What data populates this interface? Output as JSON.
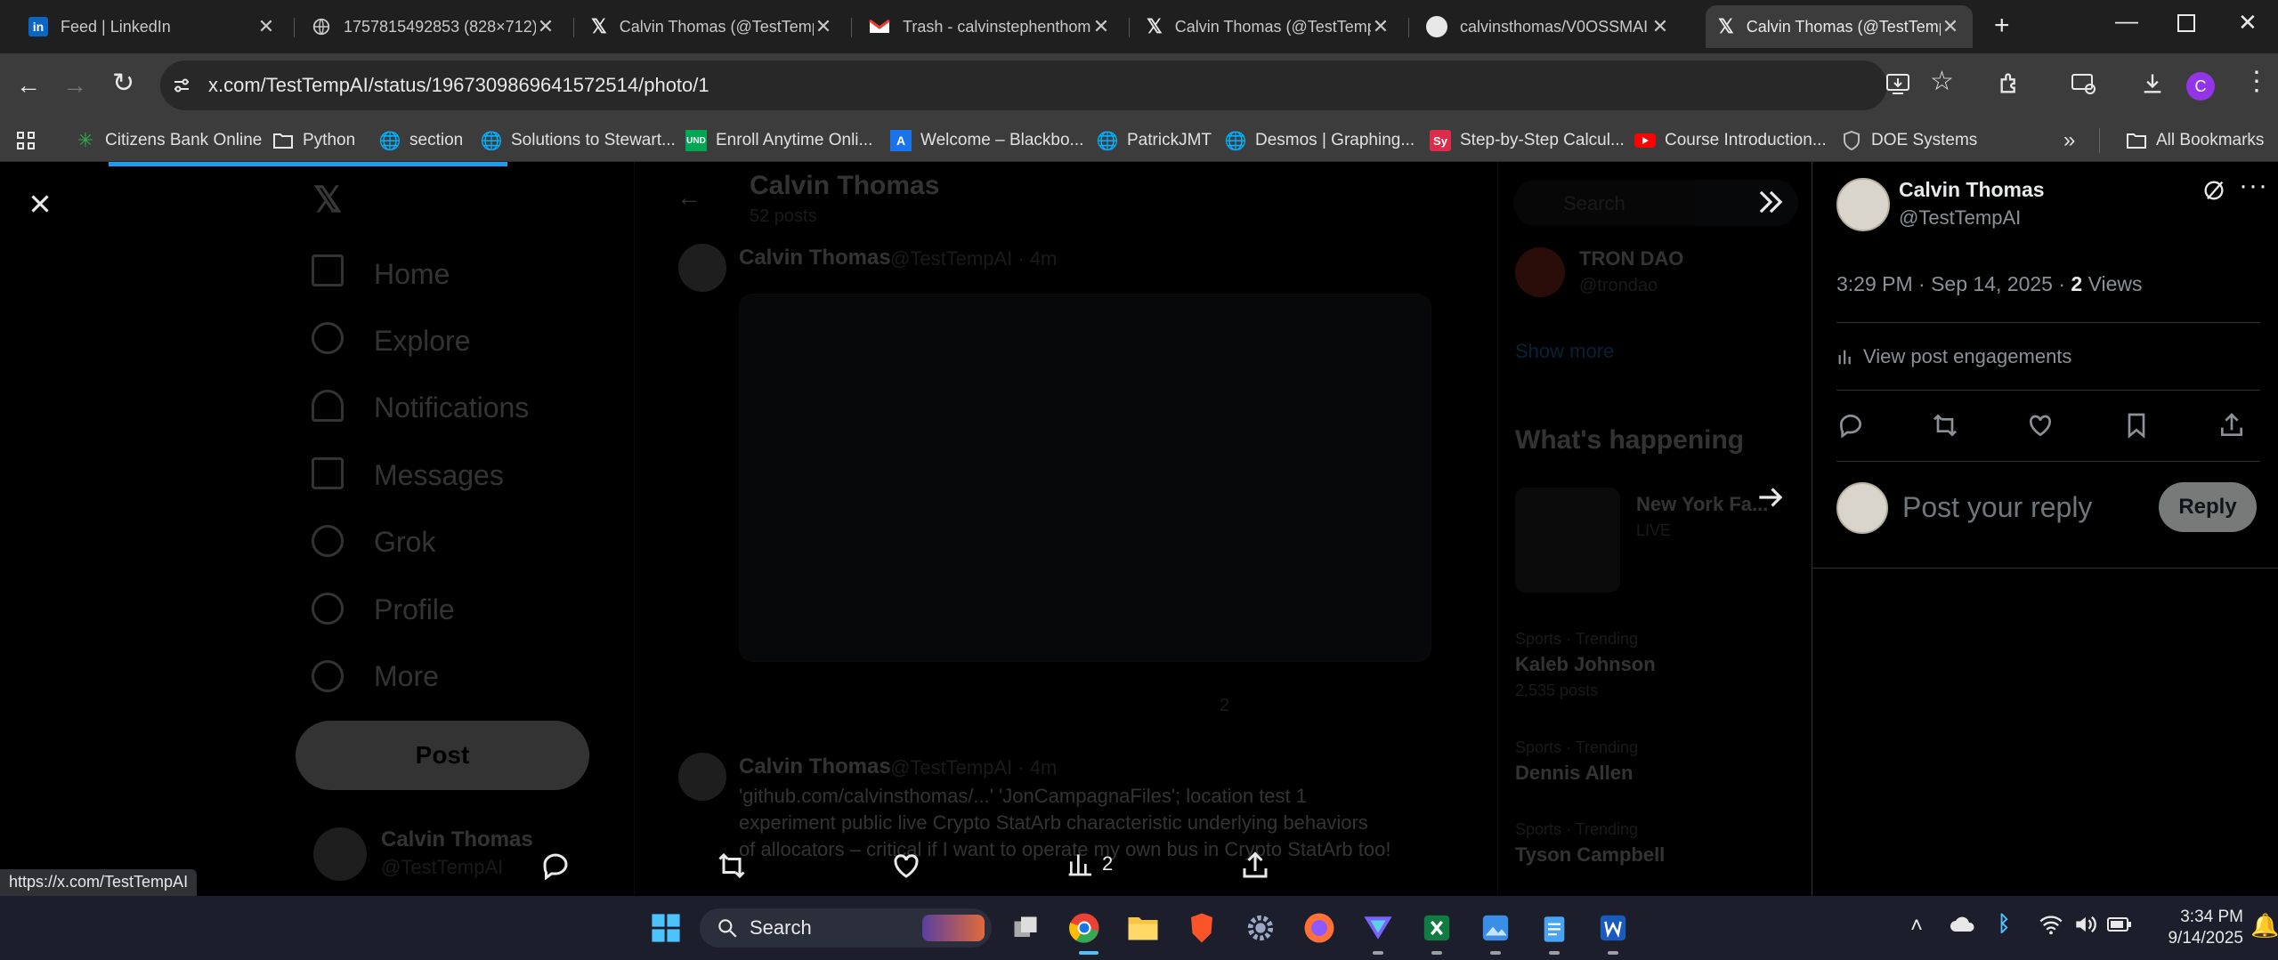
{
  "browser": {
    "tabs": [
      {
        "title": "Feed | LinkedIn",
        "icon": "linkedin-icon"
      },
      {
        "title": "1757815492853 (828×712)",
        "icon": "globe-icon"
      },
      {
        "title": "Calvin Thomas (@TestTempAI)",
        "icon": "x-logo-icon"
      },
      {
        "title": "Trash - calvinstephenthomas",
        "icon": "gmail-icon"
      },
      {
        "title": "Calvin Thomas (@TestTempAI)",
        "icon": "x-logo-icon"
      },
      {
        "title": "calvinsthomas/V0OSSMAI",
        "icon": "github-icon"
      },
      {
        "title": "Calvin Thomas (@TestTempAI)",
        "icon": "x-logo-icon"
      }
    ],
    "url": "x.com/TestTempAI/status/1967309869641572514/photo/1",
    "bookmarks": [
      {
        "label": "Citizens Bank Online",
        "icon": "citizens-icon"
      },
      {
        "label": "Python",
        "icon": "folder-icon"
      },
      {
        "label": "section",
        "icon": "globe-icon"
      },
      {
        "label": "Solutions to Stewart...",
        "icon": "globe-icon"
      },
      {
        "label": "Enroll Anytime Onli...",
        "icon": "und-icon"
      },
      {
        "label": "Welcome – Blackbo...",
        "icon": "blackboard-icon"
      },
      {
        "label": "PatrickJMT",
        "icon": "globe-icon"
      },
      {
        "label": "Desmos | Graphing...",
        "icon": "globe-icon"
      },
      {
        "label": "Step-by-Step Calcul...",
        "icon": "symbolab-icon"
      },
      {
        "label": "Course Introduction...",
        "icon": "youtube-icon"
      },
      {
        "label": "DOE Systems",
        "icon": "shield-icon"
      }
    ],
    "all_bookmarks": "All Bookmarks",
    "profile_initial": "C",
    "status_url": "https://x.com/TestTempAI"
  },
  "background": {
    "nav": [
      "Home",
      "Explore",
      "Notifications",
      "Messages",
      "Grok",
      "Profile",
      "More"
    ],
    "post_button": "Post",
    "profile_name": "Calvin Thomas",
    "profile_handle": "@TestTempAI",
    "header_name": "Calvin Thomas",
    "header_sub": "52 posts",
    "tweet1_name": "Calvin Thomas",
    "tweet1_meta": "@TestTempAI · 4m",
    "tweet1_views": "2",
    "tweet2_name": "Calvin Thomas",
    "tweet2_meta": "@TestTempAI · 4m",
    "tweet2_text1": "'github.com/calvinsthomas/...' 'JonCampagnaFiles'; location test 1",
    "tweet2_text2": "experiment public live Crypto StatArb characteristic underlying behaviors",
    "tweet2_text3": "of allocators – critical if I want to operate my own bus in Crypto StatArb too!",
    "search": "Search",
    "sidebar_account": "TRON DAO",
    "sidebar_handle": "@trondao",
    "show_more": "Show more",
    "whats_happening": "What's happening",
    "trend_event": "New York Fa...",
    "trend_event_sub": "LIVE",
    "trends": [
      {
        "meta": "Sports · Trending",
        "name": "Kaleb Johnson",
        "count": "2,535 posts"
      },
      {
        "meta": "Sports · Trending",
        "name": "Dennis Allen",
        "count": ""
      },
      {
        "meta": "Sports · Trending",
        "name": "Tyson Campbell",
        "count": ""
      }
    ]
  },
  "photo_controls": {
    "views": "2"
  },
  "post_panel": {
    "author_name": "Calvin Thomas",
    "author_handle": "@TestTempAI",
    "timestamp": "3:29 PM · Sep 14, 2025 · ",
    "views_count": "2",
    "views_label": " Views",
    "engagements": "View post engagements",
    "reply_placeholder": "Post your reply",
    "reply_button": "Reply"
  },
  "taskbar": {
    "search_label": "Search",
    "time": "3:34 PM",
    "date": "9/14/2025"
  },
  "colors": {
    "accent": "#1d9bf0",
    "tab_active": "#3c3c3c",
    "taskbar": "#1c1f2b"
  }
}
